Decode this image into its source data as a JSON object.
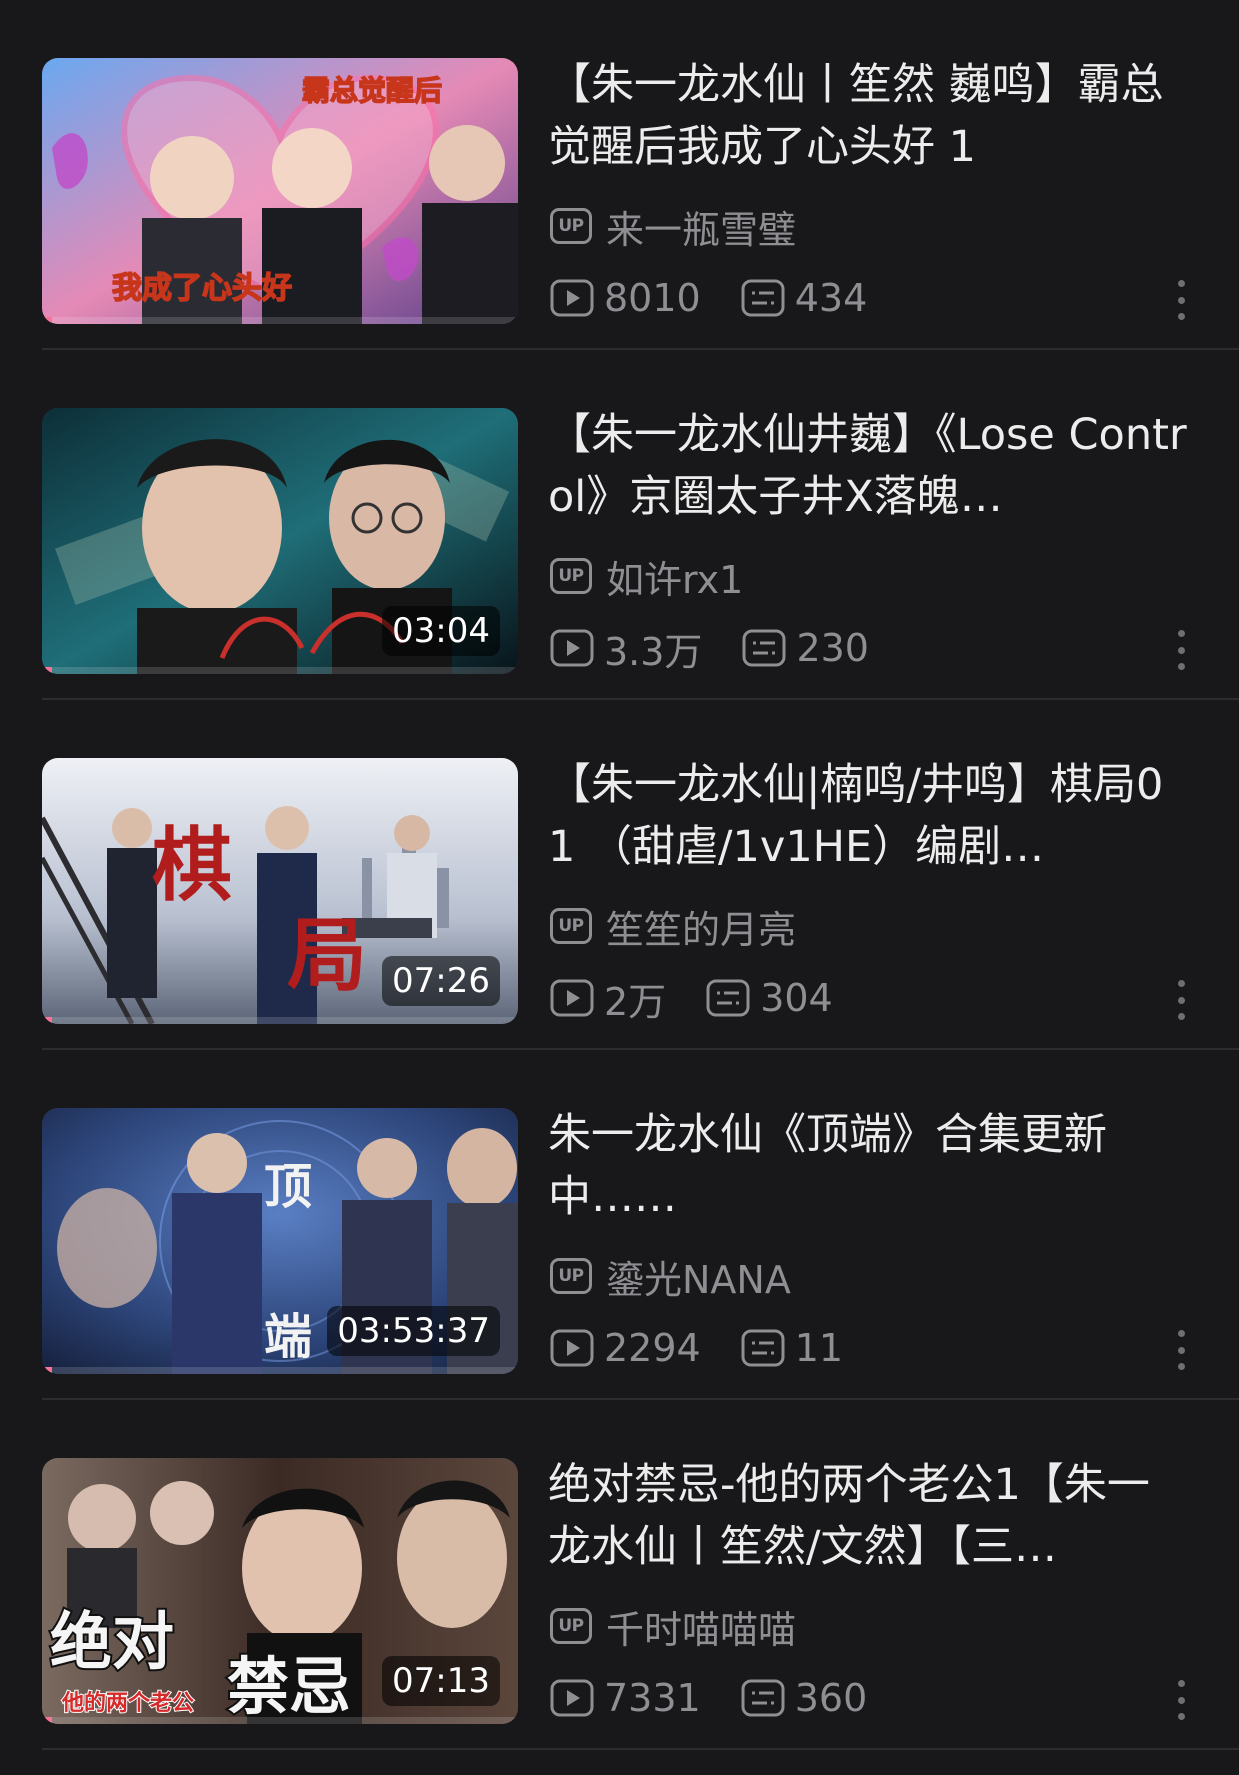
{
  "colors": {
    "background": "#18181a",
    "divider": "#2c2c2f",
    "title": "#ececec",
    "meta": "#8e8e93",
    "accent": "#fb7299"
  },
  "icons": {
    "uploader": "up-badge-icon",
    "views": "play-count-icon",
    "danmaku": "danmaku-count-icon",
    "more": "more-vertical-icon"
  },
  "videos": [
    {
      "title": "【朱一龙水仙丨笙然 巍鸣】霸总觉醒后我成了心头好 1",
      "up_badge": "UP",
      "uploader": "来一瓶雪璧",
      "views": "8010",
      "danmaku": "434",
      "duration": "",
      "watched": 0.02,
      "thumb_colors": [
        "#5fa0e8",
        "#e86a9a",
        "#c84b7d"
      ],
      "thumb_text": [
        "霸总觉醒后",
        "我成了心头好"
      ]
    },
    {
      "title": "【朱一龙水仙井巍】《Lose Control》京圈太子井X落魄…",
      "up_badge": "UP",
      "uploader": "如许rx1",
      "views": "3.3万",
      "danmaku": "230",
      "duration": "03:04",
      "watched": 0.02,
      "thumb_colors": [
        "#0e3b46",
        "#1f6e78",
        "#0a1c22"
      ],
      "thumb_text": []
    },
    {
      "title": "【朱一龙水仙|楠鸣/井鸣】棋局01 （甜虐/1v1HE）编剧…",
      "up_badge": "UP",
      "uploader": "笙笙的月亮",
      "views": "2万",
      "danmaku": "304",
      "duration": "07:26",
      "watched": 0.02,
      "thumb_colors": [
        "#d8dbe4",
        "#9aa3b6",
        "#3f4758"
      ],
      "thumb_text": [
        "棋",
        "局"
      ]
    },
    {
      "title": "朱一龙水仙《顶端》合集更新中……",
      "up_badge": "UP",
      "uploader": "鎏光NANA",
      "views": "2294",
      "danmaku": "11",
      "duration": "03:53:37",
      "watched": 0.02,
      "thumb_colors": [
        "#2a3d6a",
        "#3f5f99",
        "#1b2747"
      ],
      "thumb_text": [
        "顶",
        "端"
      ]
    },
    {
      "title": "绝对禁忌-他的两个老公1【朱一龙水仙丨笙然/文然】【三…",
      "up_badge": "UP",
      "uploader": "千时喵喵喵",
      "views": "7331",
      "danmaku": "360",
      "duration": "07:13",
      "watched": 0.02,
      "thumb_colors": [
        "#3b2a24",
        "#7a5b4a",
        "#1d1412"
      ],
      "thumb_text": [
        "绝对",
        "禁忌",
        "他的两个老公"
      ]
    }
  ]
}
